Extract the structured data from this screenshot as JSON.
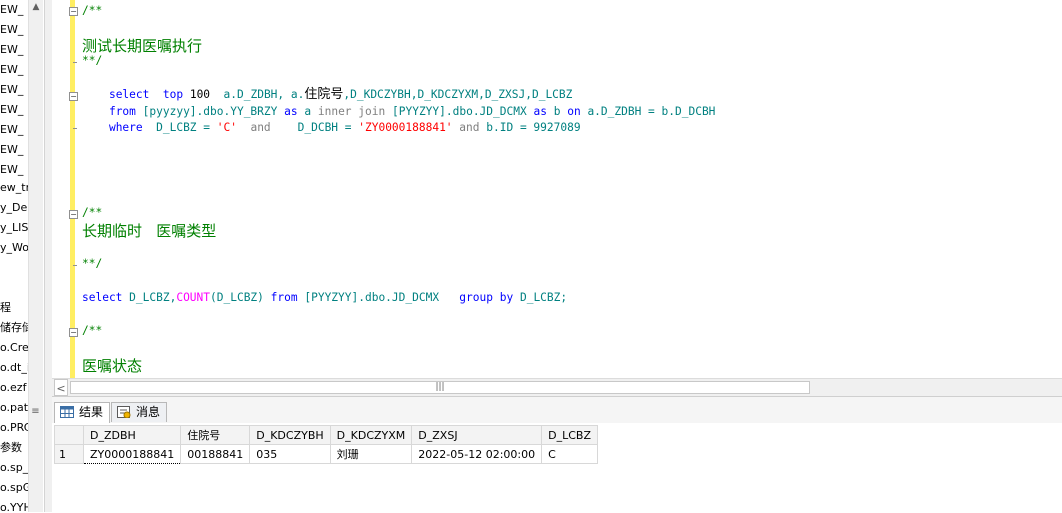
{
  "object_explorer": {
    "items": [
      "EW_",
      "EW_",
      "EW_",
      "EW_",
      "EW_",
      "EW_",
      "EW_",
      "EW_",
      "EW_",
      "ew_tr",
      "y_Dep",
      "y_LIS",
      "y_Wo",
      "",
      "",
      "程",
      "储存储",
      "o.Cre",
      "o.dt_i",
      "o.ezf",
      "o.pat",
      "o.PRC",
      "参数",
      "o.sp_",
      "o.spG",
      "o.YYH"
    ]
  },
  "editor": {
    "lines": {
      "block1_open": "/**",
      "block1_text": "测试长期医嘱执行",
      "block1_close": "**/",
      "q1_l1": {
        "kw1": "select",
        "kw2": "top",
        "num": "100",
        "cols1": "a.D_ZDBH, a.",
        "cjk": "住院号",
        "cols2": ",D_KDCZYBH,D_KDCZYXM,D_ZXSJ,D_LCBZ"
      },
      "q1_l2": {
        "kw": "from",
        "t1": "[pyyzyy].dbo.YY_BRZY",
        "as1": "as",
        "alias1": "a",
        "j1": "inner",
        "j2": "join",
        "t2": "[PYYZYY].dbo.JD_DCMX",
        "as2": "as",
        "alias2": "b",
        "on": "on",
        "cond": "a.D_ZDBH = b.D_DCBH"
      },
      "q1_l3": {
        "kw": "where",
        "c1": "D_LCBZ = ",
        "v1": "'C'",
        "and1": "and",
        "c2": "D_DCBH = ",
        "v2": "'ZY0000188841'",
        "and2": "and",
        "c3": "b.ID = 9927089"
      },
      "block2_open": "/**",
      "block2_text": "长期临时   医嘱类型",
      "block2_close": "**/",
      "q2": {
        "kw1": "select",
        "c1": "D_LCBZ,",
        "fn": "COUNT",
        "c2": "(D_LCBZ)",
        "kw2": "from",
        "t": "[PYYZYY].dbo.JD_DCMX",
        "kw3": "group",
        "kw4": "by",
        "c3": "D_LCBZ;"
      },
      "block3_open": "/**",
      "block3_text": "医嘱状态"
    },
    "colors": {
      "comment": "#008000",
      "keyword": "#0000ff",
      "gray_keyword": "#808080",
      "identifier": "#008080",
      "string": "#ff0000",
      "function": "#ff00ff",
      "modified_bar": "#ffee62"
    }
  },
  "hscroll": {
    "thumb_grip": "|||"
  },
  "results": {
    "tabs": [
      {
        "label": "结果",
        "icon": "grid-results-icon"
      },
      {
        "label": "消息",
        "icon": "messages-icon"
      }
    ],
    "columns": [
      "D_ZDBH",
      "住院号",
      "D_KDCZYBH",
      "D_KDCZYXM",
      "D_ZXSJ",
      "D_LCBZ"
    ],
    "rows": [
      {
        "rn": "1",
        "cells": [
          "ZY0000188841",
          "00188841",
          "035",
          "刘珊",
          "2022-05-12 02:00:00",
          "C"
        ]
      }
    ]
  }
}
